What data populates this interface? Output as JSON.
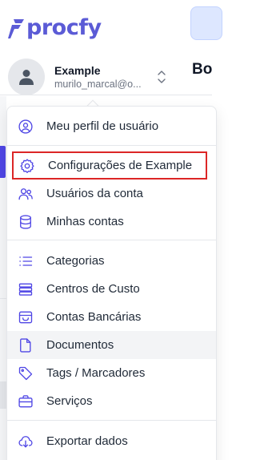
{
  "brand": {
    "name": "procfy",
    "color": "#5b5bd6",
    "icon": "procfy-logo-icon"
  },
  "page": {
    "heading": "Bo"
  },
  "user": {
    "name": "Example",
    "email": "murilo_marcal@o...",
    "avatar_icon": "user-avatar-icon",
    "toggle_icon": "chevrons-up-down-icon"
  },
  "menu": {
    "highlight_color": "#dc2626",
    "items": [
      {
        "label": "Meu perfil de usuário",
        "icon": "user-circle-icon"
      },
      {
        "label": "Configurações de Example",
        "icon": "gear-icon",
        "highlighted": true
      },
      {
        "label": "Usuários da conta",
        "icon": "users-icon"
      },
      {
        "label": "Minhas contas",
        "icon": "database-icon"
      },
      {
        "label": "Categorias",
        "icon": "list-icon"
      },
      {
        "label": "Centros de Custo",
        "icon": "server-stack-icon"
      },
      {
        "label": "Contas Bancárias",
        "icon": "bank-box-icon"
      },
      {
        "label": "Documentos",
        "icon": "document-icon",
        "hovered": true
      },
      {
        "label": "Tags / Marcadores",
        "icon": "tag-icon"
      },
      {
        "label": "Serviços",
        "icon": "briefcase-icon"
      },
      {
        "label": "Exportar dados",
        "icon": "cloud-download-icon"
      }
    ]
  }
}
